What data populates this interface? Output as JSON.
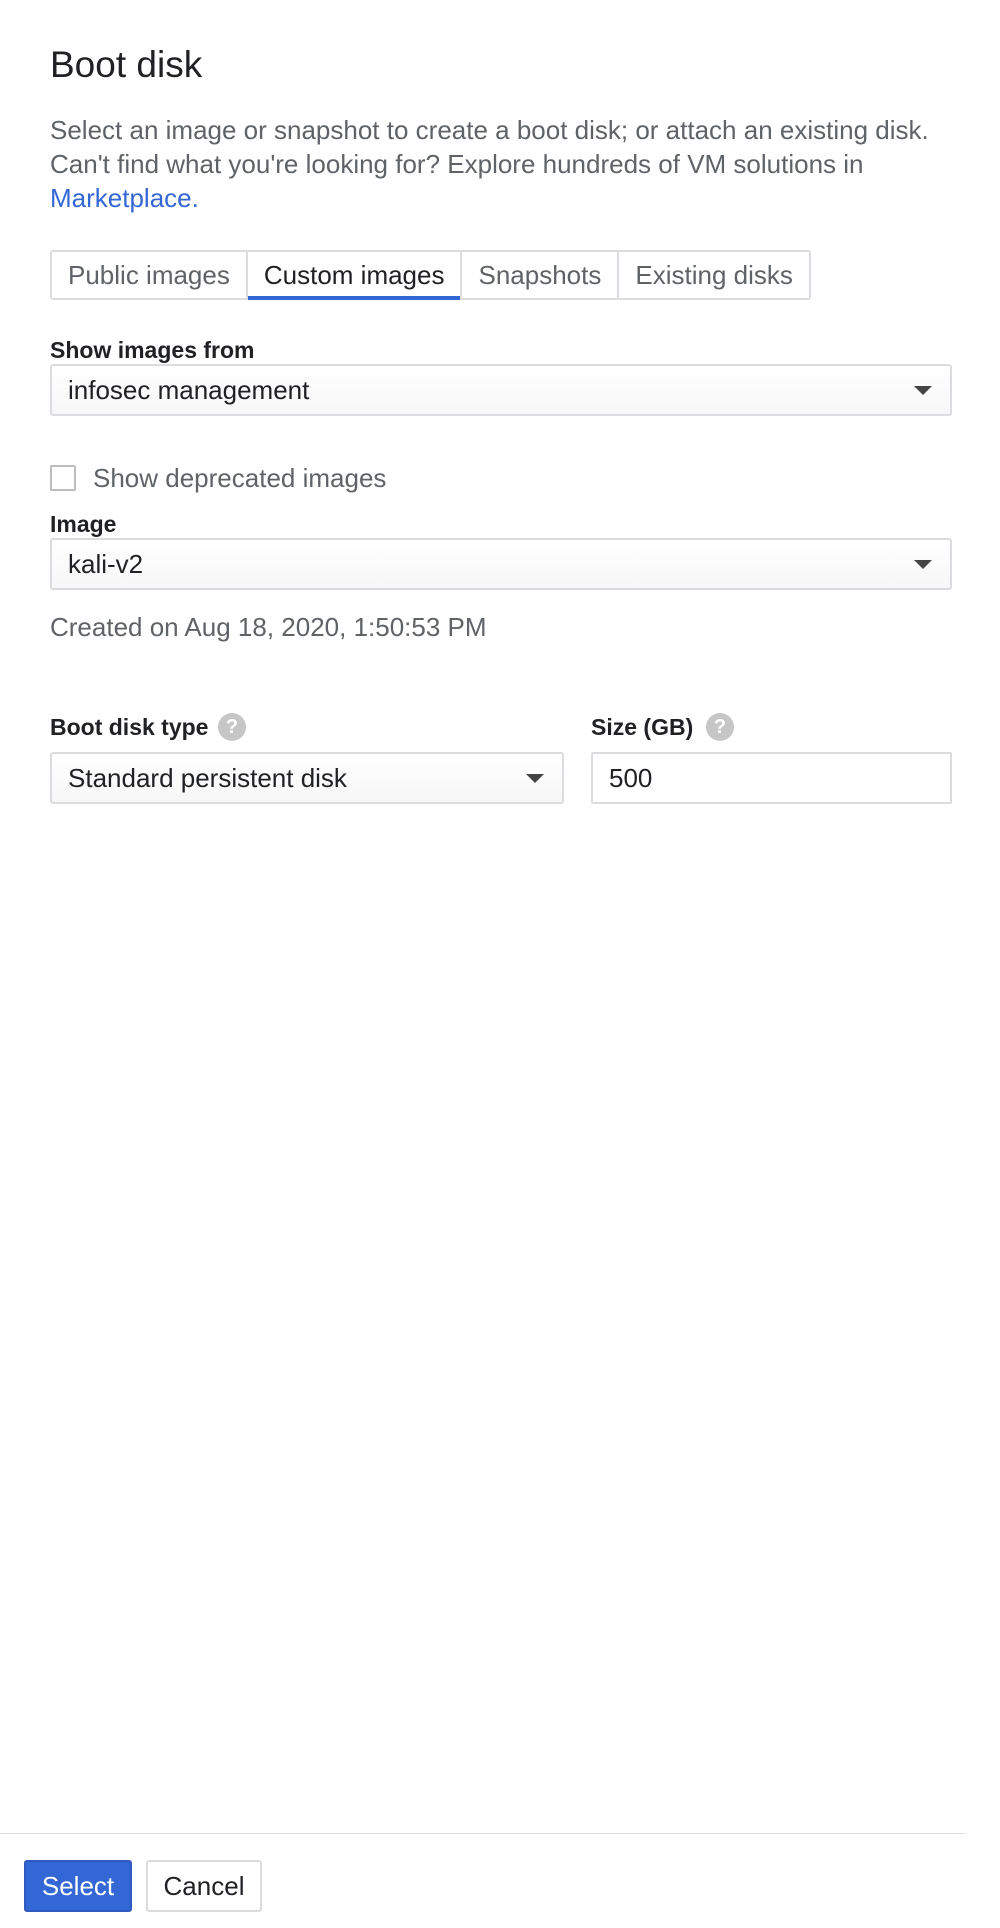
{
  "header": {
    "title": "Boot disk",
    "description_line1": "Select an image or snapshot to create a boot disk; or attach an existing disk.",
    "description_line2": "Can't find what you're looking for? Explore hundreds of VM solutions in",
    "marketplace_link": "Marketplace."
  },
  "tabs": [
    {
      "label": "Public images",
      "active": false
    },
    {
      "label": "Custom images",
      "active": true
    },
    {
      "label": "Snapshots",
      "active": false
    },
    {
      "label": "Existing disks",
      "active": false
    }
  ],
  "show_images_from": {
    "label": "Show images from",
    "value": "infosec management"
  },
  "deprecated": {
    "label": "Show deprecated images",
    "checked": false
  },
  "image": {
    "label": "Image",
    "value": "kali-v2",
    "created": "Created on Aug 18, 2020, 1:50:53 PM"
  },
  "boot_disk_type": {
    "label": "Boot disk type",
    "value": "Standard persistent disk",
    "help_icon": "?"
  },
  "size": {
    "label": "Size (GB)",
    "value": "500",
    "help_icon": "?"
  },
  "footer": {
    "select_label": "Select",
    "cancel_label": "Cancel"
  },
  "colors": {
    "accent": "#3367d6",
    "text": "#202124",
    "muted_text": "#5f6368",
    "border": "#dadce0"
  }
}
